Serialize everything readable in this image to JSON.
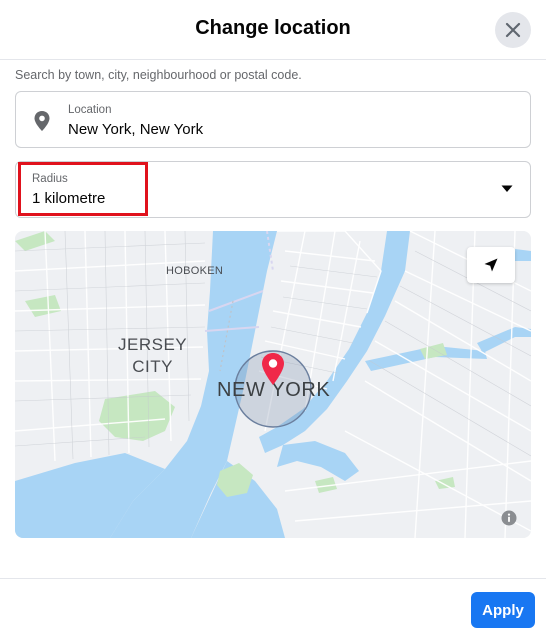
{
  "dialog": {
    "title": "Change location",
    "close_icon": "close-icon"
  },
  "search_hint": "Search by town, city, neighbourhood or postal code.",
  "location_field": {
    "label": "Location",
    "value": "New York, New York",
    "icon": "location-pin-icon"
  },
  "radius_field": {
    "label": "Radius",
    "value": "1 kilometre",
    "icon": "dropdown-caret-icon"
  },
  "map": {
    "labels": {
      "hoboken": "HOBOKEN",
      "jersey_city_line1": "JERSEY",
      "jersey_city_line2": "CITY",
      "new_york": "NEW YORK"
    },
    "marker_icon": "map-marker-icon",
    "locate_icon": "navigation-arrow-icon",
    "info_icon": "info-icon",
    "colors": {
      "water": "#a8d4f5",
      "land": "#eef0f3",
      "park": "#c6e7c1",
      "marker": "#f02849",
      "radius_circle": "#6b7f9e"
    }
  },
  "footer": {
    "apply_label": "Apply"
  },
  "annotation": {
    "highlight_color": "#e0121d"
  }
}
